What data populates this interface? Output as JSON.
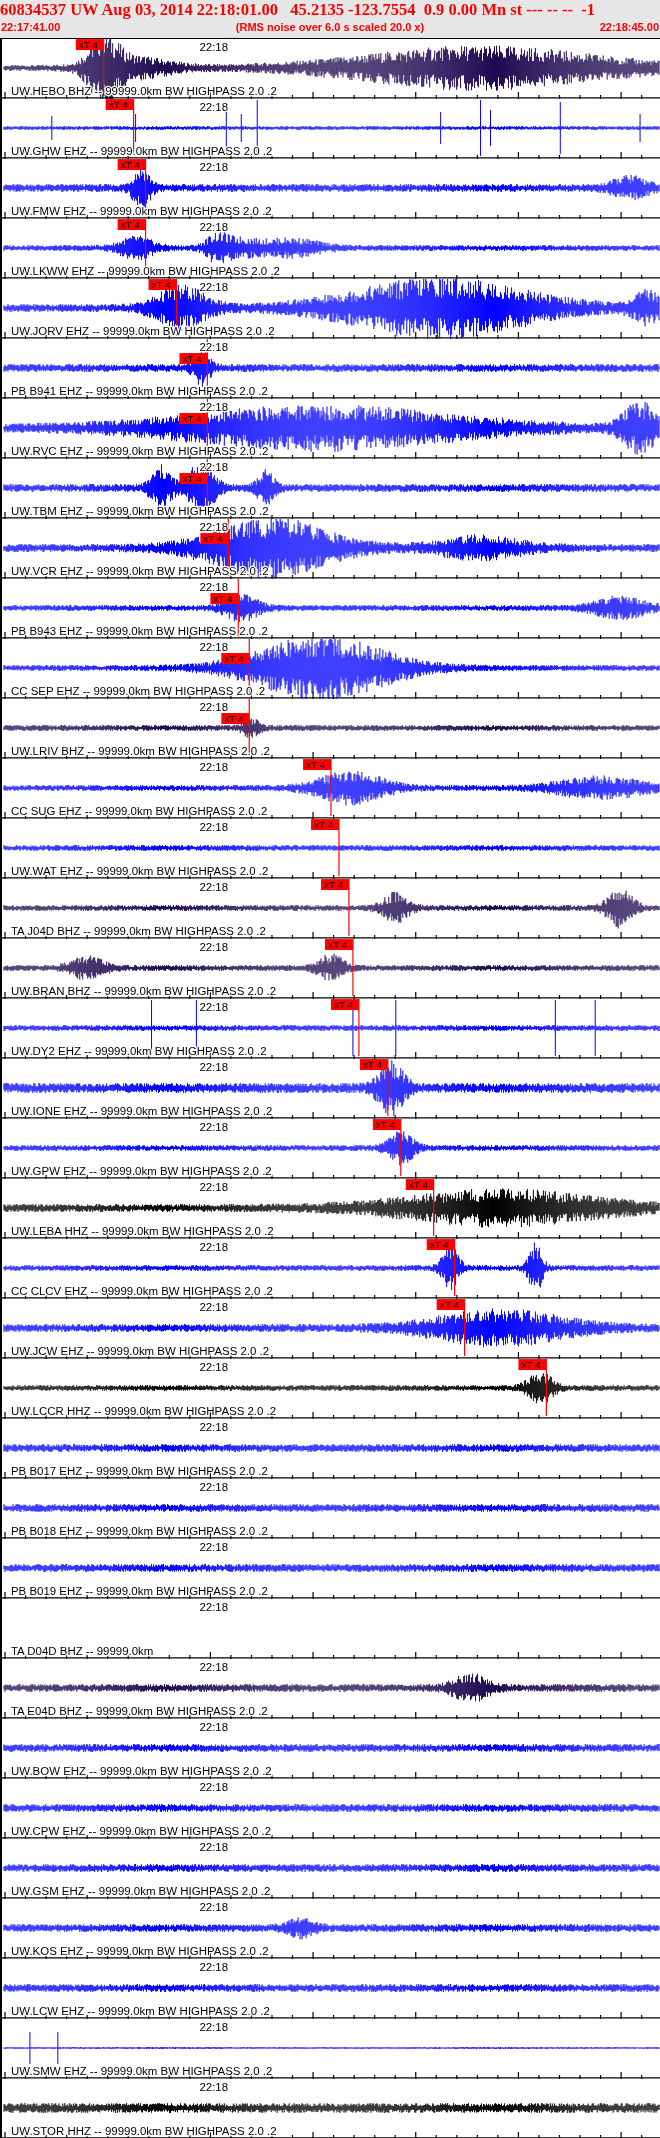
{
  "header": {
    "title": "60834537 UW Aug 03, 2014 22:18:01.00   45.2135 -123.7554  0.9 0.00 Mn st --- -- --  -1",
    "start_time": "22:17:41.00",
    "note": "(RMS noise over 6.0 s scaled 20.0 x)",
    "end_time": "22:18:45.00"
  },
  "traces": [
    {
      "kind": "waveform",
      "label": "UW.HEBO BHZ -- 99999.0km BW HIGHPASS 2.0 .2",
      "time_label": "22:18",
      "color": "#1e0a50",
      "pick": "xT 4"
    },
    {
      "kind": "waveform",
      "label": "UW.GHW EHZ -- 99999.0km BW HIGHPASS 2.0 .2",
      "time_label": "22:18",
      "color": "#0000ff",
      "pick": "xT 4"
    },
    {
      "kind": "waveform",
      "label": "UW.FMW EHZ -- 99999.0km BW HIGHPASS 2.0 .2",
      "time_label": "22:18",
      "color": "#0000ff",
      "pick": "xT 4"
    },
    {
      "kind": "waveform",
      "label": "UW.LKWW EHZ -- 99999.0km BW HIGHPASS 2.0 .2",
      "time_label": "22:18",
      "color": "#0000ff",
      "pick": "xT 4"
    },
    {
      "kind": "waveform",
      "label": "UW.JORV EHZ -- 99999.0km BW HIGHPASS 2.0 .2",
      "time_label": "22:18",
      "color": "#0000ff",
      "pick": "xT 4"
    },
    {
      "kind": "waveform",
      "label": "PB B941 EHZ -- 99999.0km BW HIGHPASS 2.0 .2",
      "time_label": "22:18",
      "color": "#0000ff",
      "pick": "xT 4"
    },
    {
      "kind": "waveform",
      "label": "UW.RVC EHZ -- 99999.0km BW HIGHPASS 2.0 .2",
      "time_label": "22:18",
      "color": "#0000ff",
      "pick": "xT 4"
    },
    {
      "kind": "waveform",
      "label": "UW.TBM EHZ -- 99999.0km BW HIGHPASS 2.0 .2",
      "time_label": "22:18",
      "color": "#0000ff",
      "pick": "xT 4"
    },
    {
      "kind": "waveform",
      "label": "UW.VCR EHZ -- 99999.0km BW HIGHPASS 2.0 .2",
      "time_label": "22:18",
      "color": "#0000ff",
      "pick": "xT 4"
    },
    {
      "kind": "waveform",
      "label": "PB B943 EHZ -- 99999.0km BW HIGHPASS 2.0 .2",
      "time_label": "22:18",
      "color": "#0000ff",
      "pick": "xT 4"
    },
    {
      "kind": "waveform",
      "label": "CC SEP EHZ -- 99999.0km BW HIGHPASS 2.0 .2",
      "time_label": "22:18",
      "color": "#0000ff",
      "pick": "xT 4"
    },
    {
      "kind": "waveform",
      "label": "UW.LRIV BHZ -- 99999.0km BW HIGHPASS 2.0 .2",
      "time_label": "22:18",
      "color": "#1e0a50",
      "pick": "xT 4"
    },
    {
      "kind": "waveform",
      "label": "CC SUG EHZ -- 99999.0km BW HIGHPASS 2.0 .2",
      "time_label": "22:18",
      "color": "#0000ff",
      "pick": "xT 4"
    },
    {
      "kind": "waveform",
      "label": "UW.WAT EHZ -- 99999.0km BW HIGHPASS 2.0 .2",
      "time_label": "22:18",
      "color": "#0000ff",
      "pick": "xT 4"
    },
    {
      "kind": "waveform",
      "label": "TA J04D BHZ -- 99999.0km BW HIGHPASS 2.0 .2",
      "time_label": "22:18",
      "color": "#1e0a50",
      "pick": "xT 4"
    },
    {
      "kind": "waveform",
      "label": "UW.BRAN BHZ -- 99999.0km BW HIGHPASS 2.0 .2",
      "time_label": "22:18",
      "color": "#1e0a50",
      "pick": "xT 4"
    },
    {
      "kind": "waveform",
      "label": "UW.DY2 EHZ -- 99999.0km BW HIGHPASS 2.0 .2",
      "time_label": "22:18",
      "color": "#0000ff",
      "pick": "xT 4"
    },
    {
      "kind": "waveform",
      "label": "UW.IONE EHZ -- 99999.0km BW HIGHPASS 2.0 .2",
      "time_label": "22:18",
      "color": "#0000ff",
      "pick": "xT 4"
    },
    {
      "kind": "waveform",
      "label": "UW.GPW EHZ -- 99999.0km BW HIGHPASS 2.0 .2",
      "time_label": "22:18",
      "color": "#0000ff",
      "pick": "xT 4"
    },
    {
      "kind": "waveform",
      "label": "UW.LEBA HHZ -- 99999.0km BW HIGHPASS 2.0 .2",
      "time_label": "22:18",
      "color": "#000000",
      "pick": "xT 4"
    },
    {
      "kind": "waveform",
      "label": "CC CLCV EHZ -- 99999.0km BW HIGHPASS 2.0 .2",
      "time_label": "22:18",
      "color": "#0000ff",
      "pick": "xT 4"
    },
    {
      "kind": "waveform",
      "label": "UW.JCW EHZ -- 99999.0km BW HIGHPASS 2.0 .2",
      "time_label": "22:18",
      "color": "#0000ff",
      "pick": "xT 4"
    },
    {
      "kind": "waveform",
      "label": "UW.LCCR HHZ -- 99999.0km BW HIGHPASS 2.0 .2",
      "time_label": "22:18",
      "color": "#000000",
      "pick": "xT 4"
    },
    {
      "kind": "waveform",
      "label": "PB B017 EHZ -- 99999.0km BW HIGHPASS 2.0 .2",
      "time_label": "22:18",
      "color": "#0000ff"
    },
    {
      "kind": "waveform",
      "label": "PB B018 EHZ -- 99999.0km BW HIGHPASS 2.0 .2",
      "time_label": "22:18",
      "color": "#0000ff"
    },
    {
      "kind": "waveform",
      "label": "PB B019 EHZ -- 99999.0km BW HIGHPASS 2.0 .2",
      "time_label": "22:18",
      "color": "#0000ff"
    },
    {
      "kind": "empty",
      "label": "TA D04D BHZ -- 99999.0km",
      "time_label": "22:18"
    },
    {
      "kind": "waveform",
      "label": "TA E04D BHZ -- 99999.0km BW HIGHPASS 2.0 .2",
      "time_label": "22:18",
      "color": "#1e0a50"
    },
    {
      "kind": "waveform",
      "label": "UW.BOW EHZ -- 99999.0km BW HIGHPASS 2.0 .2",
      "time_label": "22:18",
      "color": "#0000ff"
    },
    {
      "kind": "waveform",
      "label": "UW.CPW EHZ -- 99999.0km BW HIGHPASS 2.0 .2",
      "time_label": "22:18",
      "color": "#0000ff"
    },
    {
      "kind": "waveform",
      "label": "UW.GSM EHZ -- 99999.0km BW HIGHPASS 2.0 .2",
      "time_label": "22:18",
      "color": "#0000ff"
    },
    {
      "kind": "waveform",
      "label": "UW.KOS EHZ -- 99999.0km BW HIGHPASS 2.0 .2",
      "time_label": "22:18",
      "color": "#0000ff"
    },
    {
      "kind": "waveform",
      "label": "UW.LCW EHZ -- 99999.0km BW HIGHPASS 2.0 .2",
      "time_label": "22:18",
      "color": "#0000ff"
    },
    {
      "kind": "waveform",
      "label": "UW.SMW EHZ -- 99999.0km BW HIGHPASS 2.0 .2",
      "time_label": "22:18",
      "color": "#0000ff"
    },
    {
      "kind": "waveform",
      "label": "UW.STOR HHZ -- 99999.0km BW HIGHPASS 2.0 .2",
      "time_label": "22:18",
      "color": "#000000"
    }
  ]
}
